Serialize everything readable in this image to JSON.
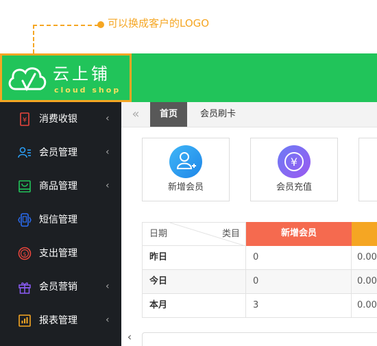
{
  "note": {
    "text": "可以换成客户的LOGO"
  },
  "logo": {
    "name": "云上铺",
    "tagline": "cloud shop"
  },
  "sidebar": {
    "items": [
      {
        "label": "消费收银",
        "icon": "receipt-icon",
        "color": "#e8453c",
        "arrow": "‹"
      },
      {
        "label": "会员管理",
        "icon": "member-list-icon",
        "color": "#2a9df4",
        "arrow": "‹"
      },
      {
        "label": "商品管理",
        "icon": "shopping-bag-icon",
        "color": "#21c45a",
        "arrow": "‹"
      },
      {
        "label": "短信管理",
        "icon": "phone-icon",
        "color": "#2a6df4",
        "arrow": ""
      },
      {
        "label": "支出管理",
        "icon": "dollar-coin-icon",
        "color": "#e8453c",
        "arrow": ""
      },
      {
        "label": "会员营销",
        "icon": "gift-icon",
        "color": "#8b5cf6",
        "arrow": "‹"
      },
      {
        "label": "报表管理",
        "icon": "bar-chart-icon",
        "color": "#f5a623",
        "arrow": "‹"
      }
    ]
  },
  "tabs": {
    "prev": "«",
    "home": "首页",
    "member_card": "会员刷卡"
  },
  "cards": [
    {
      "label": "新增会员",
      "icon": "add-user-icon",
      "color": "#2a9df4"
    },
    {
      "label": "会员充值",
      "icon": "yuan-coin-icon",
      "color": "#7c5cf0"
    }
  ],
  "table": {
    "header_date": "日期",
    "header_category": "类目",
    "header_new_member": "新增会员",
    "header_new_member_color": "#f56a4f",
    "header_next_color": "#f5a623",
    "rows": [
      {
        "label": "昨日",
        "new_member": "0",
        "next": "0.00"
      },
      {
        "label": "今日",
        "new_member": "0",
        "next": "0.00"
      },
      {
        "label": "本月",
        "new_member": "3",
        "next": "0.00"
      }
    ]
  },
  "collapse_arrow": "‹"
}
